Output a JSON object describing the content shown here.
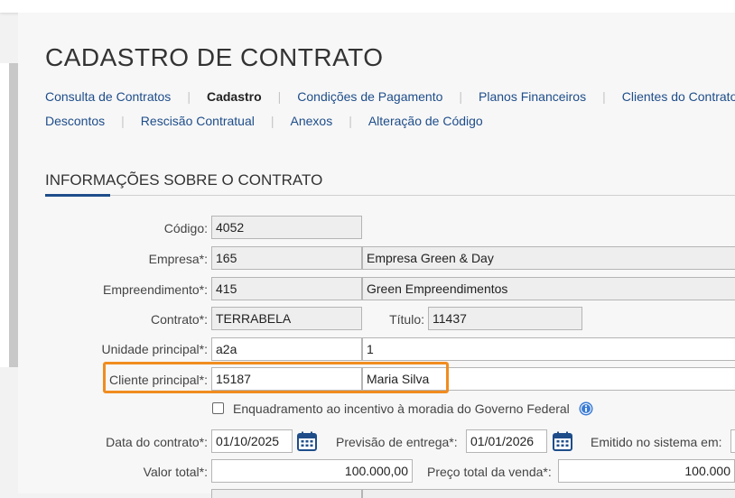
{
  "page": {
    "title": "CADASTRO DE CONTRATO"
  },
  "nav": {
    "row1": [
      {
        "label": "Consulta de Contratos",
        "active": false
      },
      {
        "label": "Cadastro",
        "active": true
      },
      {
        "label": "Condições de Pagamento",
        "active": false
      },
      {
        "label": "Planos Financeiros",
        "active": false
      },
      {
        "label": "Clientes do Contrato",
        "active": false
      }
    ],
    "row2": [
      {
        "label": "Descontos",
        "active": false
      },
      {
        "label": "Rescisão Contratual",
        "active": false
      },
      {
        "label": "Anexos",
        "active": false
      },
      {
        "label": "Alteração de Código",
        "active": false
      }
    ]
  },
  "section": {
    "title": "INFORMAÇÕES SOBRE O CONTRATO"
  },
  "form": {
    "codigo": {
      "label": "Código:",
      "value": "4052"
    },
    "empresa": {
      "label": "Empresa*:",
      "code": "165",
      "name": "Empresa Green & Day"
    },
    "empreendimento": {
      "label": "Empreendimento*:",
      "code": "415",
      "name": "Green Empreendimentos"
    },
    "contrato": {
      "label": "Contrato*:",
      "value": "TERRABELA"
    },
    "titulo": {
      "label": "Título:",
      "value": "11437"
    },
    "unidade": {
      "label": "Unidade principal*:",
      "code": "a2a",
      "name": "1"
    },
    "cliente": {
      "label": "Cliente principal*:",
      "code": "15187",
      "name": "Maria Silva"
    },
    "enquadramento": {
      "label": "Enquadramento ao incentivo à moradia do Governo Federal",
      "checked": false
    },
    "data_contrato": {
      "label": "Data do contrato*:",
      "value": "01/10/2025"
    },
    "previsao_entrega": {
      "label": "Previsão de entrega*:",
      "value": "01/01/2026"
    },
    "emitido": {
      "label": "Emitido no sistema em:"
    },
    "valor_total": {
      "label": "Valor total*:",
      "value": "100.000,00"
    },
    "preco_total": {
      "label": "Preço total da venda*:",
      "value": "100.000"
    }
  },
  "icons": {
    "calendar": "calendar-icon",
    "info": "info-icon"
  },
  "colors": {
    "accent": "#1e4d8a",
    "highlight": "#f08c1f",
    "link": "#1e4d8a"
  }
}
